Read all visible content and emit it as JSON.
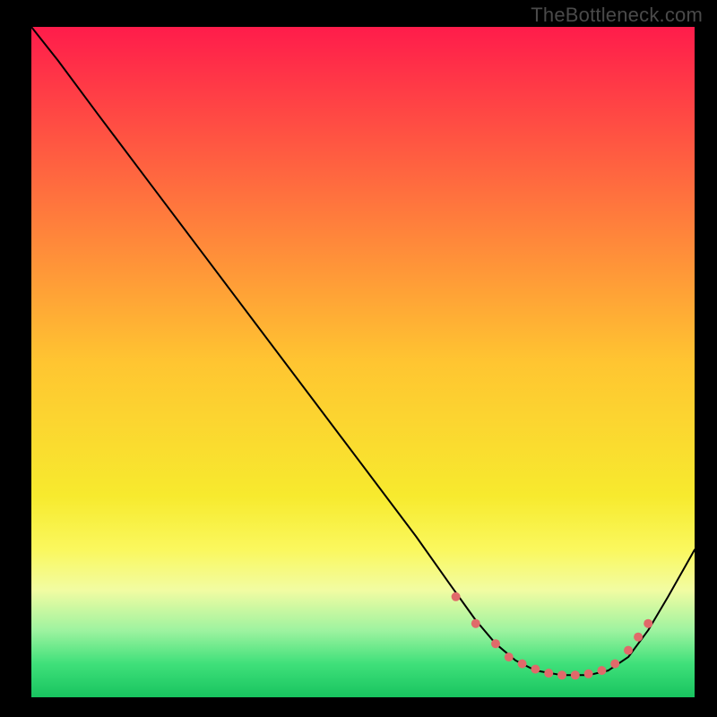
{
  "watermark": "TheBottleneck.com",
  "chart_data": {
    "type": "line",
    "title": "",
    "xlabel": "",
    "ylabel": "",
    "xlim": [
      0,
      100
    ],
    "ylim": [
      0,
      100
    ],
    "background_gradient": {
      "type": "vertical",
      "stops": [
        {
          "offset": 0.0,
          "color": "#ff1c4b"
        },
        {
          "offset": 0.5,
          "color": "#ffc531"
        },
        {
          "offset": 0.7,
          "color": "#f7ea2e"
        },
        {
          "offset": 0.78,
          "color": "#faf85e"
        },
        {
          "offset": 0.84,
          "color": "#f2fca2"
        },
        {
          "offset": 0.9,
          "color": "#9ef3a0"
        },
        {
          "offset": 0.95,
          "color": "#3fe07a"
        },
        {
          "offset": 1.0,
          "color": "#18c45f"
        }
      ]
    },
    "series": [
      {
        "name": "curve",
        "color": "#000000",
        "stroke_width": 2,
        "x": [
          0,
          4,
          10,
          18,
          26,
          34,
          42,
          50,
          58,
          63,
          67,
          70,
          73,
          76,
          80,
          84,
          87,
          90,
          93,
          96,
          100
        ],
        "y": [
          100,
          95,
          87,
          76.5,
          66,
          55.5,
          45,
          34.5,
          24,
          17,
          11.5,
          8,
          5.5,
          4,
          3.3,
          3.3,
          4,
          6,
          10,
          15,
          22
        ]
      }
    ],
    "markers": {
      "name": "highlight-dots",
      "color": "#e06a6a",
      "radius": 5,
      "points": [
        {
          "x": 64,
          "y": 15
        },
        {
          "x": 67,
          "y": 11
        },
        {
          "x": 70,
          "y": 8
        },
        {
          "x": 72,
          "y": 6
        },
        {
          "x": 74,
          "y": 5
        },
        {
          "x": 76,
          "y": 4.2
        },
        {
          "x": 78,
          "y": 3.6
        },
        {
          "x": 80,
          "y": 3.3
        },
        {
          "x": 82,
          "y": 3.3
        },
        {
          "x": 84,
          "y": 3.5
        },
        {
          "x": 86,
          "y": 4
        },
        {
          "x": 88,
          "y": 5
        },
        {
          "x": 90,
          "y": 7
        },
        {
          "x": 91.5,
          "y": 9
        },
        {
          "x": 93,
          "y": 11
        }
      ]
    }
  }
}
